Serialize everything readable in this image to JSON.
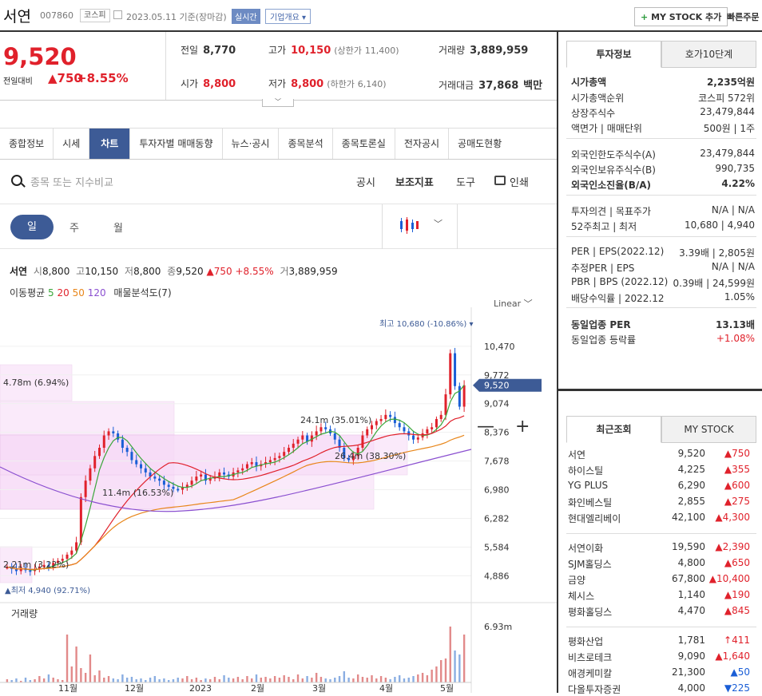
{
  "header": {
    "name": "서연",
    "code": "007860",
    "market": "코스피",
    "date": "2023.05.11 기준(장마감)",
    "live": "실시간",
    "corp_info": "기업개요",
    "mystock_button": "MY STOCK 추가",
    "quick_order": "빠른주문"
  },
  "price": {
    "current": "9,520",
    "change_label": "전일대비",
    "change": "750",
    "change_pct": "+8.55%"
  },
  "summary": {
    "prev_label": "전일",
    "prev": "8,770",
    "high_label": "고가",
    "high": "10,150",
    "upper_label": "(상한가",
    "upper": "11,400)",
    "volume_label": "거래량",
    "volume": "3,889,959",
    "open_label": "시가",
    "open": "8,800",
    "low_label": "저가",
    "low": "8,800",
    "lower_label": "(하한가",
    "lower": "6,140)",
    "amount_label": "거래대금",
    "amount": "37,868",
    "amount_unit": "백만"
  },
  "tabs": [
    "종합정보",
    "시세",
    "차트",
    "투자자별 매매동향",
    "뉴스·공시",
    "종목분석",
    "종목토론실",
    "전자공시",
    "공매도현황"
  ],
  "chart_toolbar": {
    "search_placeholder": "종목 또는 지수비교",
    "notice": "공시",
    "indicator": "보조지표",
    "tools": "도구",
    "print": "인쇄"
  },
  "periods": {
    "day": "일",
    "week": "주",
    "month": "월"
  },
  "legend": {
    "name": "서연",
    "open_l": "시",
    "open": "8,800",
    "high_l": "고",
    "high": "10,150",
    "low_l": "저",
    "low": "8,800",
    "close_l": "종",
    "close": "9,520",
    "chg": "▲750",
    "pct": "+8.55%",
    "vol_l": "거",
    "vol": "3,889,959",
    "ma_label": "이동평균",
    "ma5": "5",
    "ma20": "20",
    "ma50": "50",
    "ma120": "120",
    "vp": "매물분석도(7)"
  },
  "scale_mode": "Linear",
  "chart_data": {
    "type": "candlestick",
    "y_ticks": [
      "10,470",
      "9,772",
      "9,074",
      "8,376",
      "7,678",
      "6,980",
      "6,282",
      "5,584",
      "4,886"
    ],
    "x_ticks": [
      "11월",
      "12월",
      "2023",
      "2월",
      "3월",
      "4월",
      "5월"
    ],
    "current_label": "9,520",
    "max_label": "최고 10,680 (-10.86%)",
    "min_label": "최저 4,940 (92.71%)",
    "volume_label": "거래량",
    "volume_tick": "6.93m",
    "volume_profile": [
      "4.78m (6.94%)",
      "11.4m (16.53%)",
      "24.1m (35.01%)",
      "26.4m (38.30%)",
      "2.21m (3.22%)"
    ],
    "close_series": [
      5100,
      5050,
      5000,
      5080,
      5020,
      5000,
      5050,
      5100,
      5150,
      5120,
      5200,
      5250,
      5300,
      5400,
      5500,
      5700,
      6800,
      7200,
      7500,
      7800,
      8000,
      8300,
      8400,
      8350,
      8200,
      8000,
      7900,
      7700,
      7600,
      7500,
      7400,
      7300,
      7250,
      7200,
      7100,
      7050,
      7000,
      6980,
      7050,
      7100,
      7200,
      7300,
      7350,
      7200,
      7250,
      7300,
      7400,
      7350,
      7300,
      7400,
      7450,
      7500,
      7600,
      7650,
      7550,
      7600,
      7650,
      7700,
      7750,
      7800,
      7900,
      8000,
      8100,
      8200,
      8300,
      8150,
      8300,
      8400,
      8500,
      8450,
      8350,
      8200,
      8000,
      7750,
      7700,
      7800,
      8000,
      8300,
      8450,
      8550,
      8650,
      8700,
      8800,
      8750,
      8600,
      8500,
      8400,
      8300,
      8200,
      8250,
      8350,
      8450,
      8500,
      8700,
      8800,
      9300,
      10300,
      9500,
      9000,
      9520
    ]
  },
  "right": {
    "tabs": [
      "투자정보",
      "호가10단계"
    ],
    "rows": [
      {
        "k": "시가총액",
        "v": "2,235억원",
        "b": true
      },
      {
        "k": "시가총액순위",
        "v": "코스피 572위"
      },
      {
        "k": "상장주식수",
        "v": "23,479,844"
      },
      {
        "k": "액면가 | 매매단위",
        "v": "500원 | 1주"
      },
      {
        "k": "외국인한도주식수(A)",
        "v": "23,479,844"
      },
      {
        "k": "외국인보유주식수(B)",
        "v": "990,735"
      },
      {
        "k": "외국인소진율(B/A)",
        "v": "4.22%",
        "b": true
      },
      {
        "k": "투자의견 | 목표주가",
        "v": "N/A | N/A"
      },
      {
        "k": "52주최고 | 최저",
        "v": "10,680 | 4,940"
      },
      {
        "k": "PER | EPS(2022.12)",
        "v": "3.39배 | 2,805원"
      },
      {
        "k": "추정PER | EPS",
        "v": "N/A | N/A"
      },
      {
        "k": "PBR | BPS (2022.12)",
        "v": "0.39배 | 24,599원"
      },
      {
        "k": "배당수익률 | 2022.12",
        "v": "1.05%"
      },
      {
        "k": "동일업종 PER",
        "v": "13.13배",
        "b": true
      },
      {
        "k": "동일업종 등락률",
        "v": "+1.08%"
      }
    ],
    "recent_tabs": [
      "최근조회",
      "MY STOCK"
    ],
    "recent": [
      {
        "n": "서연",
        "p": "9,520",
        "c": "▲750"
      },
      {
        "n": "하이스틸",
        "p": "4,225",
        "c": "▲355"
      },
      {
        "n": "YG PLUS",
        "p": "6,290",
        "c": "▲600"
      },
      {
        "n": "화인베스틸",
        "p": "2,855",
        "c": "▲275"
      },
      {
        "n": "현대엘리베이",
        "p": "42,100",
        "c": "▲4,300"
      },
      {
        "n": "서연이화",
        "p": "19,590",
        "c": "▲2,390"
      },
      {
        "n": "SJM홀딩스",
        "p": "4,800",
        "c": "▲650"
      },
      {
        "n": "금양",
        "p": "67,800",
        "c": "▲10,400"
      },
      {
        "n": "체시스",
        "p": "1,140",
        "c": "▲190"
      },
      {
        "n": "평화홀딩스",
        "p": "4,470",
        "c": "▲845"
      },
      {
        "n": "평화산업",
        "p": "1,781",
        "c": "↑411"
      },
      {
        "n": "비츠로테크",
        "p": "9,090",
        "c": "▲1,640"
      },
      {
        "n": "애경케미칼",
        "p": "21,300",
        "c": "▲50",
        "blue": true
      },
      {
        "n": "다올투자증권",
        "p": "4,000",
        "c": "▼225",
        "blue": true
      }
    ]
  },
  "colors": {
    "up": "#e0212b",
    "down": "#1a5ed6",
    "accent": "#3d5b96",
    "profile": "#f4d7f4"
  }
}
